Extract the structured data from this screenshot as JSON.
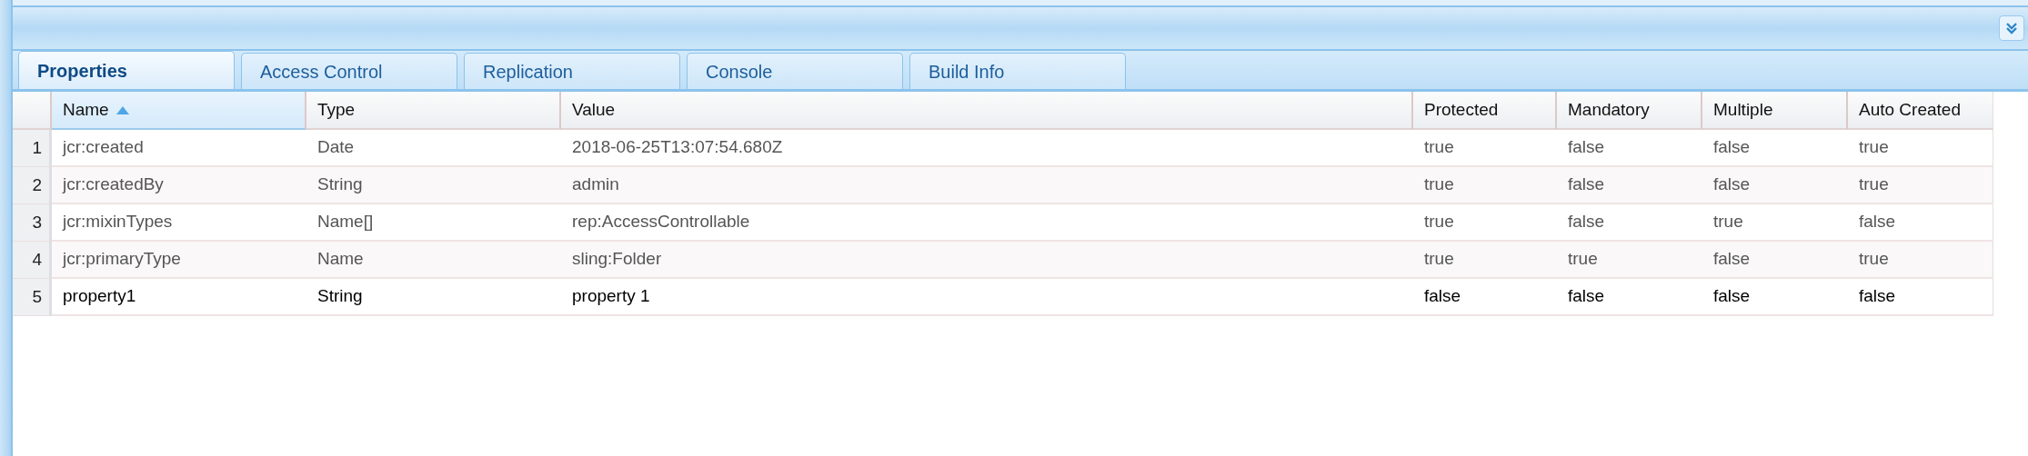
{
  "tabs": [
    {
      "label": "Properties",
      "selected": true
    },
    {
      "label": "Access Control",
      "selected": false
    },
    {
      "label": "Replication",
      "selected": false
    },
    {
      "label": "Console",
      "selected": false
    },
    {
      "label": "Build Info",
      "selected": false
    }
  ],
  "table": {
    "columns": [
      {
        "label": "Name",
        "sorted": true
      },
      {
        "label": "Type",
        "sorted": false
      },
      {
        "label": "Value",
        "sorted": false
      },
      {
        "label": "Protected",
        "sorted": false
      },
      {
        "label": "Mandatory",
        "sorted": false
      },
      {
        "label": "Multiple",
        "sorted": false
      },
      {
        "label": "Auto Created",
        "sorted": false
      }
    ],
    "rows": [
      {
        "number": "1",
        "greyed": true,
        "cells": [
          "jcr:created",
          "Date",
          "2018-06-25T13:07:54.680Z",
          "true",
          "false",
          "false",
          "true"
        ]
      },
      {
        "number": "2",
        "greyed": true,
        "cells": [
          "jcr:createdBy",
          "String",
          "admin",
          "true",
          "false",
          "false",
          "true"
        ]
      },
      {
        "number": "3",
        "greyed": true,
        "cells": [
          "jcr:mixinTypes",
          "Name[]",
          "rep:AccessControllable",
          "true",
          "false",
          "true",
          "false"
        ]
      },
      {
        "number": "4",
        "greyed": true,
        "cells": [
          "jcr:primaryType",
          "Name",
          "sling:Folder",
          "true",
          "true",
          "false",
          "true"
        ]
      },
      {
        "number": "5",
        "greyed": false,
        "cells": [
          "property1",
          "String",
          "property 1",
          "false",
          "false",
          "false",
          "false"
        ]
      }
    ]
  }
}
